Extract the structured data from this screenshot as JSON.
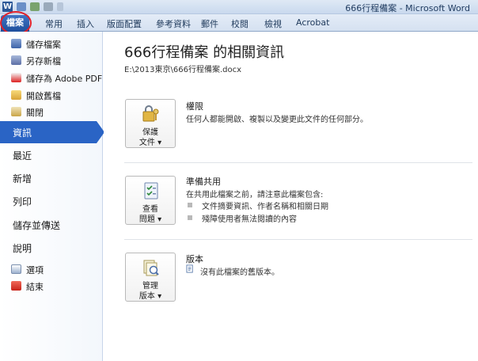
{
  "window": {
    "app_icon_letter": "W",
    "title": "666行程備案 - Microsoft Word"
  },
  "ribbon": {
    "file_tab": "檔案",
    "tabs": [
      "常用",
      "插入",
      "版面配置",
      "參考資料",
      "郵件",
      "校閱",
      "檢視",
      "Acrobat"
    ]
  },
  "backstage_nav": {
    "commands_top": [
      {
        "label": "儲存檔案",
        "icon": "save-icon"
      },
      {
        "label": "另存新檔",
        "icon": "save-as-icon"
      },
      {
        "label": "儲存為 Adobe PDF",
        "icon": "pdf-icon"
      },
      {
        "label": "開啟舊檔",
        "icon": "open-folder-icon"
      },
      {
        "label": "關閉",
        "icon": "close-document-icon"
      }
    ],
    "sections": [
      "資訊",
      "最近",
      "新增",
      "列印",
      "儲存並傳送",
      "說明"
    ],
    "active_section": "資訊",
    "commands_bottom": [
      {
        "label": "選項",
        "icon": "options-icon"
      },
      {
        "label": "結束",
        "icon": "exit-icon"
      }
    ]
  },
  "info": {
    "heading": "666行程備案 的相關資訊",
    "path": "E:\\2013東京\\666行程備案.docx",
    "permissions": {
      "button_line1": "保護",
      "button_line2": "文件",
      "title": "權限",
      "description": "任何人都能開啟、複製以及變更此文件的任何部分。"
    },
    "prepare": {
      "button_line1": "查看",
      "button_line2": "問題",
      "title": "準備共用",
      "description": "在共用此檔案之前，請注意此檔案包含:",
      "items": [
        "文件摘要資訊、作者名稱和相關日期",
        "殘障使用者無法閱讀的內容"
      ]
    },
    "versions": {
      "button_line1": "管理",
      "button_line2": "版本",
      "title": "版本",
      "description": "沒有此檔案的舊版本。"
    }
  },
  "colors": {
    "accent": "#2a64c5",
    "annotation": "#e0202a"
  }
}
